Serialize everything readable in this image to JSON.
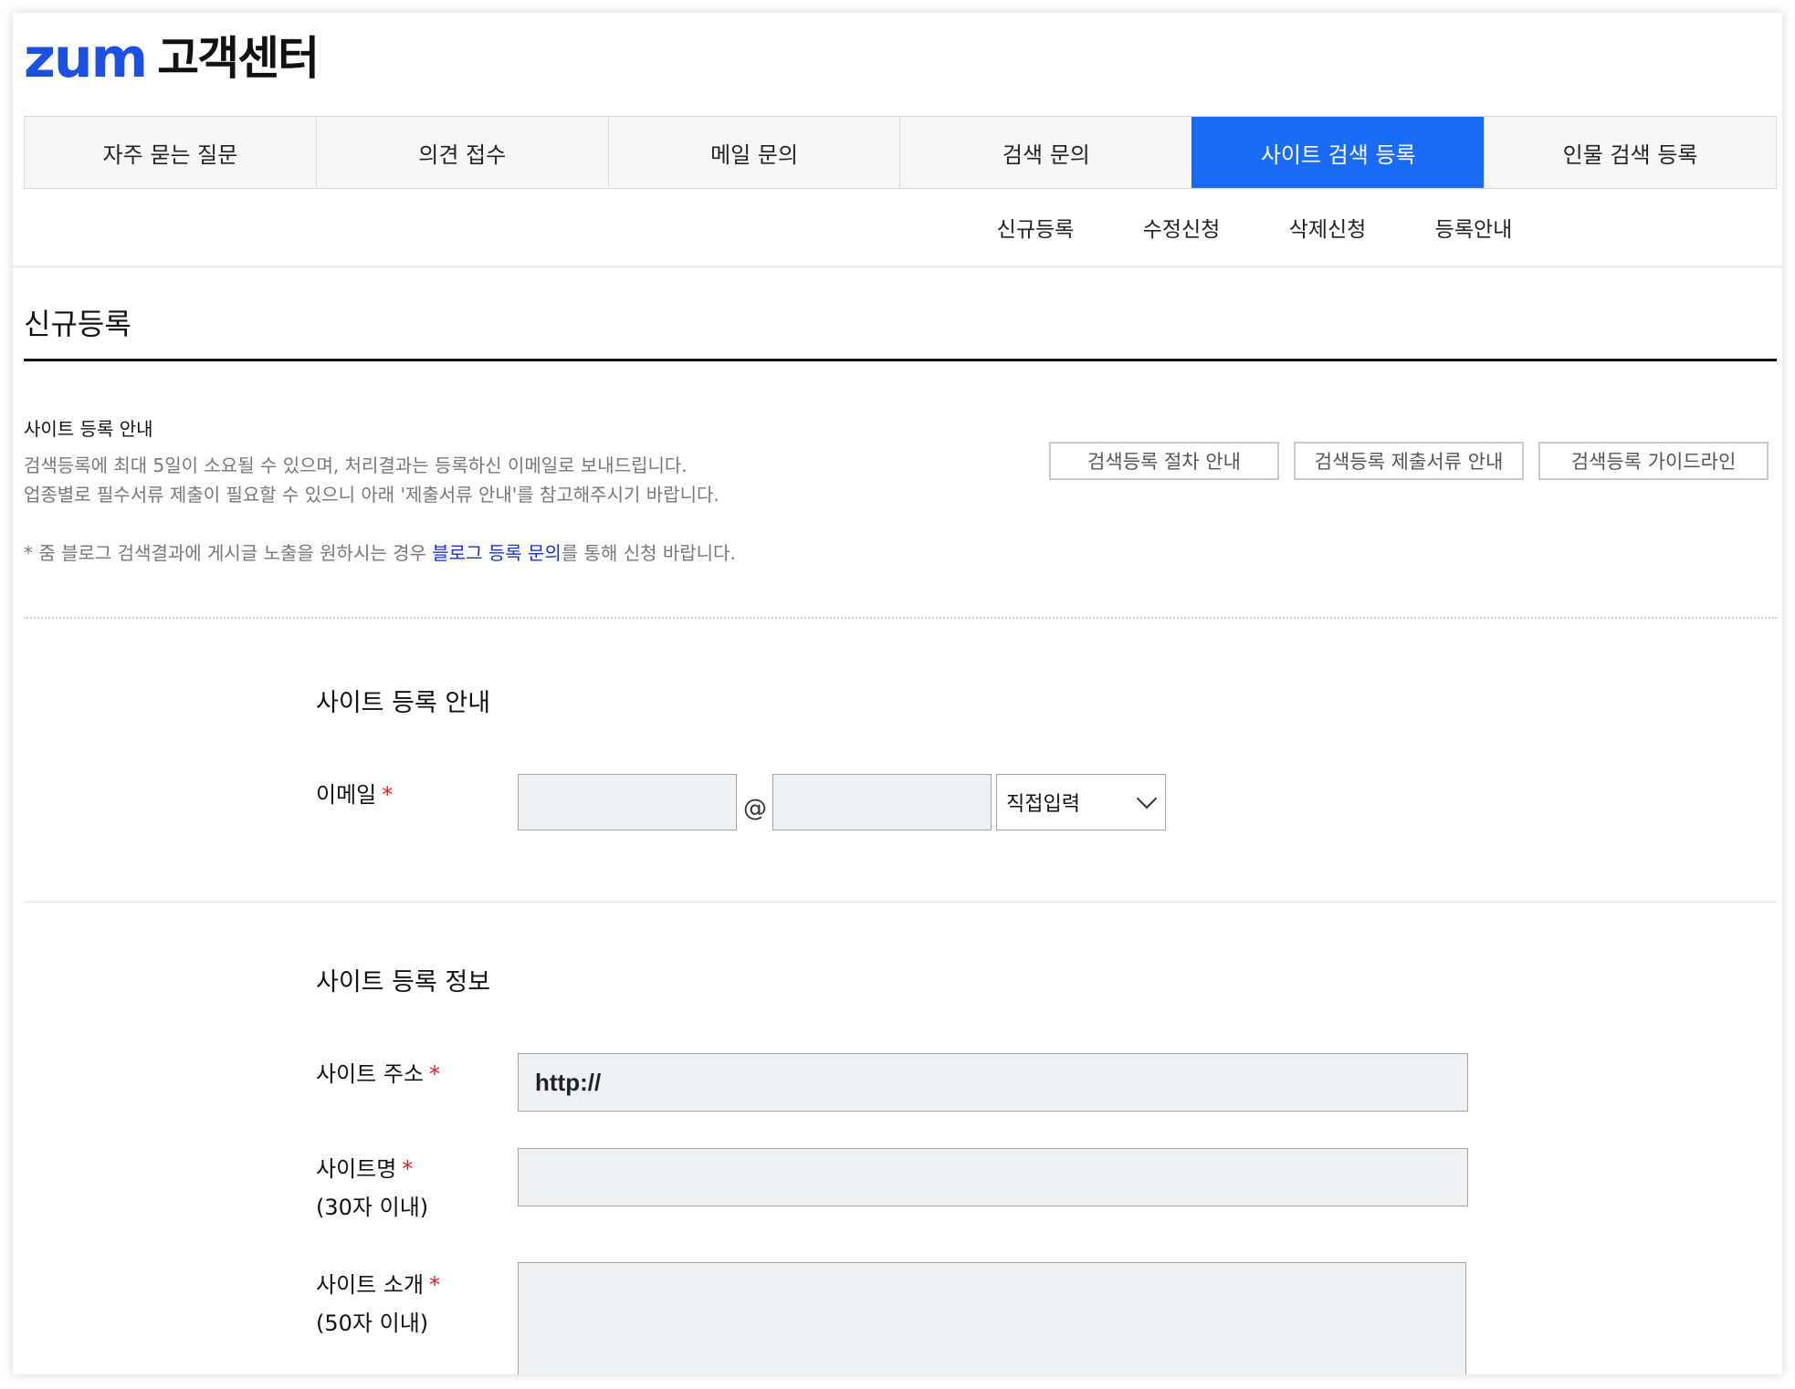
{
  "header": {
    "logo": "zum",
    "title": "고객센터"
  },
  "tabs": [
    {
      "label": "자주 묻는 질문",
      "active": false
    },
    {
      "label": "의견 접수",
      "active": false
    },
    {
      "label": "메일 문의",
      "active": false
    },
    {
      "label": "검색 문의",
      "active": false
    },
    {
      "label": "사이트 검색 등록",
      "active": true
    },
    {
      "label": "인물 검색 등록",
      "active": false
    }
  ],
  "subnav": [
    "신규등록",
    "수정신청",
    "삭제신청",
    "등록안내"
  ],
  "page_title": "신규등록",
  "info": {
    "heading": "사이트 등록 안내",
    "line1": "검색등록에 최대 5일이 소요될 수 있으며, 처리결과는 등록하신 이메일로 보내드립니다.",
    "line2": "업종별로 필수서류 제출이 필요할 수 있으니 아래 '제출서류 안내'를 참고해주시기 바랍니다.",
    "notice_prefix": "* 줌 블로그 검색결과에 게시글 노출을 원하시는 경우 ",
    "notice_link": "블로그 등록 문의",
    "notice_suffix": "를 통해 신청 바랍니다.",
    "guide_buttons": [
      "검색등록 절차 안내",
      "검색등록 제출서류 안내",
      "검색등록 가이드라인"
    ]
  },
  "section_email": {
    "title": "사이트 등록 안내",
    "email_label": "이메일",
    "required_mark": "*",
    "at_symbol": "@",
    "domain_select": "직접입력"
  },
  "section_site": {
    "title": "사이트 등록 정보",
    "url_label": "사이트 주소",
    "url_value": "http://",
    "name_label": "사이트명",
    "name_hint": "(30자 이내)",
    "intro_label": "사이트 소개",
    "intro_hint": "(50자 이내)",
    "required_mark": "*"
  },
  "colors": {
    "brand": "#1d4fe0",
    "active_tab": "#1a6bf5",
    "link": "#1530d6",
    "required": "#e02020"
  }
}
